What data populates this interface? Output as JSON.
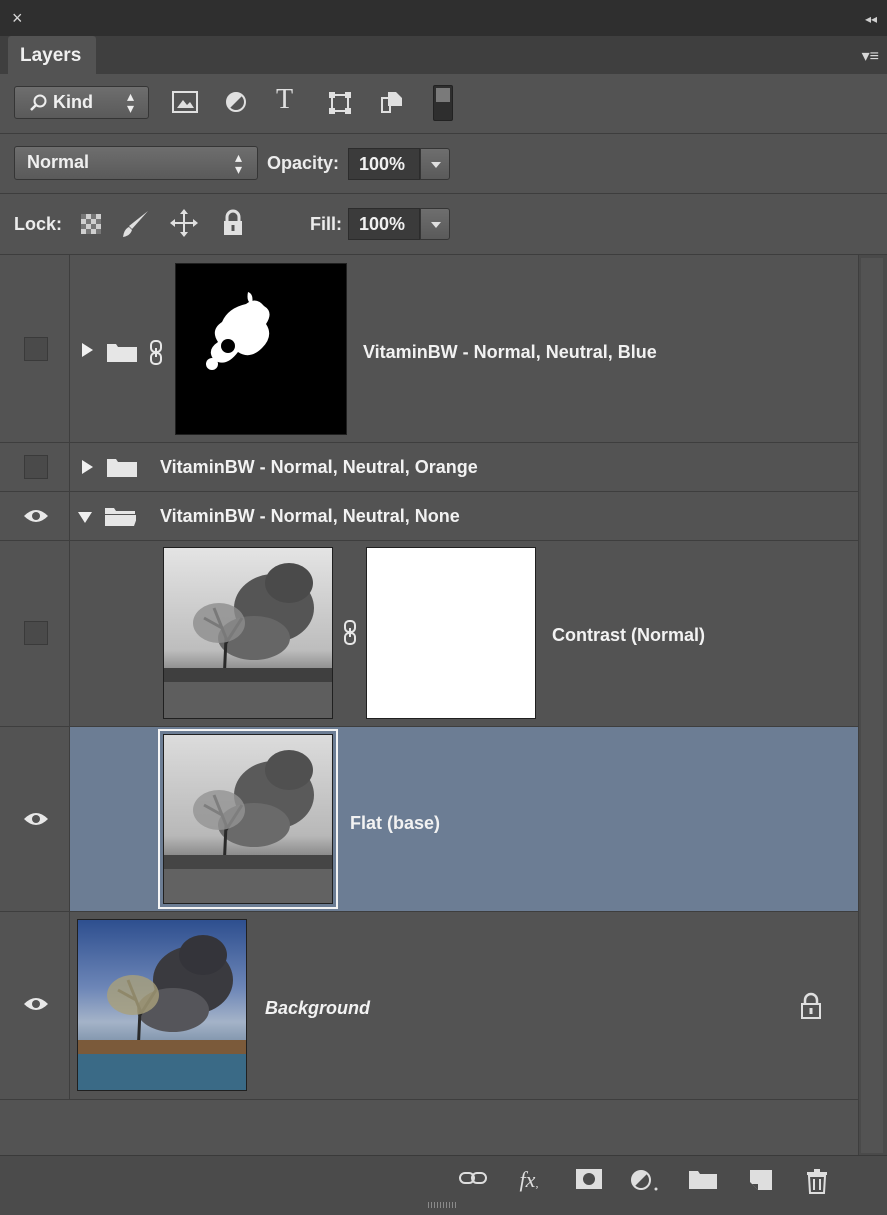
{
  "window": {
    "close_glyph": "×",
    "collapse_glyph": "◂◂",
    "menu_glyph": "▾≡"
  },
  "tab": {
    "label": "Layers"
  },
  "filter": {
    "kind_label": "Kind"
  },
  "blend": {
    "mode_value": "Normal",
    "opacity_label": "Opacity:",
    "opacity_value": "100%"
  },
  "lock": {
    "label": "Lock:",
    "fill_label": "Fill:",
    "fill_value": "100%"
  },
  "layers": [
    {
      "name": "VitaminBW - Normal, Neutral, Blue",
      "visible": false,
      "type": "group-collapsed-with-mask"
    },
    {
      "name": "VitaminBW - Normal, Neutral, Orange",
      "visible": false,
      "type": "group-collapsed"
    },
    {
      "name": "VitaminBW - Normal, Neutral, None",
      "visible": true,
      "type": "group-expanded"
    },
    {
      "name": "Contrast (Normal)",
      "visible": false,
      "type": "layer-with-mask"
    },
    {
      "name": "Flat (base)",
      "visible": true,
      "type": "layer",
      "selected": true
    },
    {
      "name": "Background",
      "visible": true,
      "type": "background",
      "locked": true
    }
  ],
  "colors": {
    "panel": "#535353",
    "selected": "#6c7d94",
    "dark": "#3b3b3b"
  },
  "bottom_icons": [
    "link-icon",
    "fx-icon",
    "mask-icon",
    "adjustment-icon",
    "folder-icon",
    "new-layer-icon",
    "trash-icon"
  ]
}
